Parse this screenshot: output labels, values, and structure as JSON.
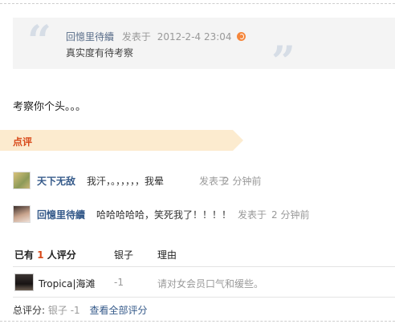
{
  "quote": {
    "author": "回憶里待續",
    "posted_label": "发表于",
    "time": "2012-2-4 23:04",
    "text": "真实度有待考察"
  },
  "post": {
    "text": "考察你个头。。。"
  },
  "rating_section": {
    "title": "点评"
  },
  "comments": [
    {
      "name": "天下无敌",
      "text": "我汗，。，，，，，我晕",
      "posted_label": "发表于",
      "time": "2 分钟前"
    },
    {
      "name": "回憶里待續",
      "text": "哈哈哈哈哈，笑死我了！！！！",
      "posted_label": "发表于",
      "time": "2 分钟前"
    }
  ],
  "ratings": {
    "header_prefix": "已有",
    "count": "1",
    "header_suffix": "人评分",
    "col_currency": "银子",
    "col_reason": "理由",
    "rows": [
      {
        "user": "Tropica|海滩",
        "value": "-1",
        "reason": "请对女会员口气和缓些。"
      }
    ],
    "summary_label": "总评分:",
    "summary_value": "银子 -1",
    "view_all_label": "查看全部评分"
  },
  "colors": {
    "accent_orange": "#d84a1a",
    "link_blue": "#355a8a",
    "rate_bar_bg": "#fcebcf"
  }
}
